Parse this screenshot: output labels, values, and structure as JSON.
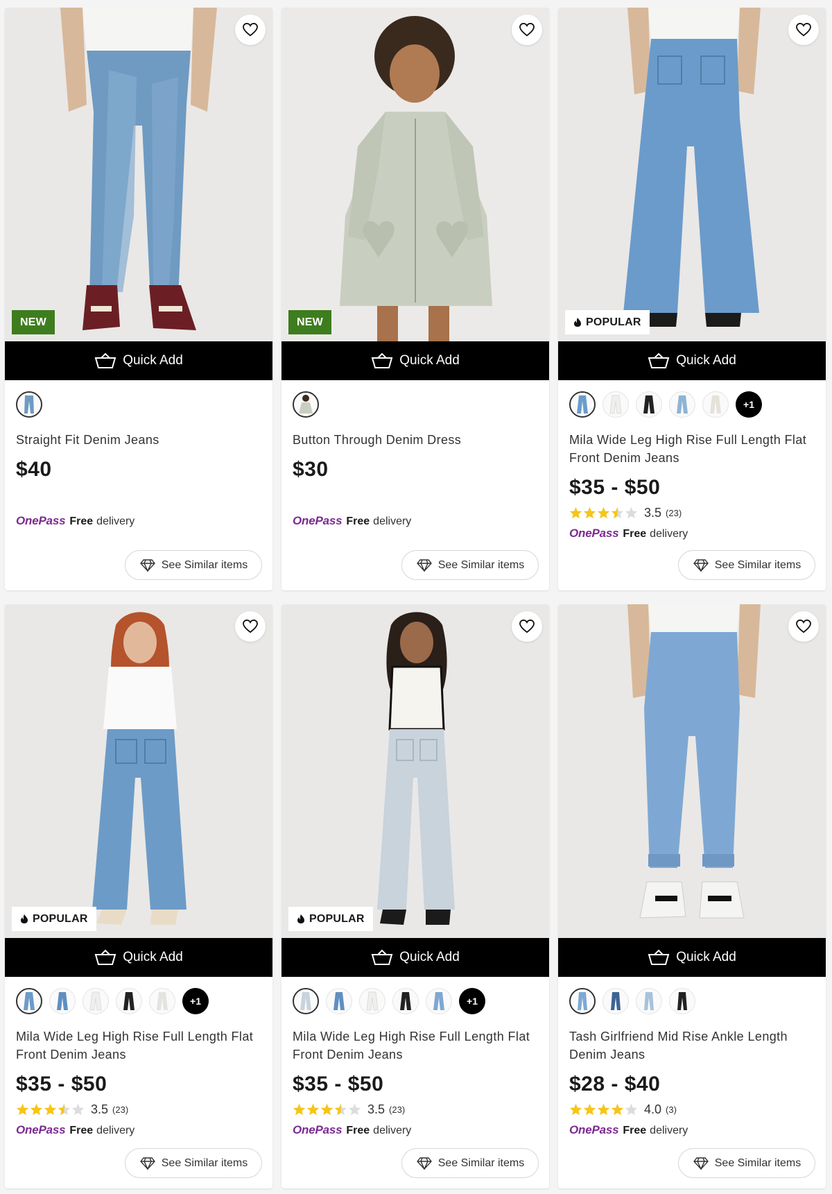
{
  "common": {
    "quick_add_label": "Quick Add",
    "see_similar_label": "See Similar items",
    "onepass_brand": "OnePass",
    "free_label": "Free",
    "delivery_label": "delivery",
    "brand_color": "#7b2a91",
    "new_badge_color": "#3e7d1e",
    "star_color": "#f5c518"
  },
  "products": [
    {
      "name": "Straight Fit Denim Jeans",
      "price": "$40",
      "badge": "NEW",
      "swatches": [
        "mid-blue"
      ],
      "more": "",
      "rating_value": "",
      "rating_count": ""
    },
    {
      "name": "Button Through Denim Dress",
      "price": "$30",
      "badge": "NEW",
      "swatches": [
        "sage"
      ],
      "more": "",
      "rating_value": "",
      "rating_count": ""
    },
    {
      "name": "Mila Wide Leg High Rise Full Length Flat Front Denim Jeans",
      "price": "$35 - $50",
      "badge": "POPULAR",
      "swatches": [
        "mid-blue",
        "white",
        "black",
        "light-blue",
        "ecru"
      ],
      "more": "+1",
      "rating_value": "3.5",
      "rating_count": "(23)",
      "rating": 3.5
    },
    {
      "name": "Mila Wide Leg High Rise Full Length Flat Front Denim Jeans",
      "price": "$35 - $50",
      "badge": "POPULAR",
      "swatches": [
        "mid-blue",
        "light-blue",
        "white",
        "black",
        "ecru"
      ],
      "more": "+1",
      "rating_value": "3.5",
      "rating_count": "(23)",
      "rating": 3.5
    },
    {
      "name": "Mila Wide Leg High Rise Full Length Flat Front Denim Jeans",
      "price": "$35 - $50",
      "badge": "POPULAR",
      "swatches": [
        "pale-grey",
        "mid-blue",
        "white",
        "black",
        "light-blue"
      ],
      "more": "+1",
      "rating_value": "3.5",
      "rating_count": "(23)",
      "rating": 3.5
    },
    {
      "name": "Tash Girlfriend Mid Rise Ankle Length Denim Jeans",
      "price": "$28 - $40",
      "badge": "",
      "swatches": [
        "mid-blue",
        "dark-blue",
        "light-blue",
        "black"
      ],
      "more": "",
      "rating_value": "4.0",
      "rating_count": "(3)",
      "rating": 4.0
    }
  ]
}
